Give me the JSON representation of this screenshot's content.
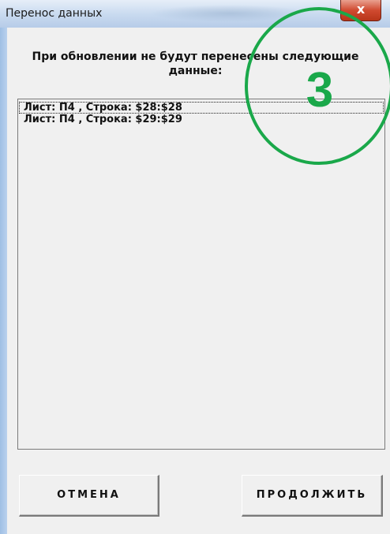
{
  "window": {
    "title": "Перенос данных",
    "close_label": "x"
  },
  "dialog": {
    "header": "При обновлении не будут перенесены следующие данные:"
  },
  "list": {
    "items": [
      "Лист: П4 , Строка: $28:$28",
      "Лист: П4 , Строка: $29:$29"
    ]
  },
  "buttons": {
    "cancel_label": "ОТМЕНА",
    "continue_label": "ПРОДОЛЖИТЬ"
  },
  "annotation": {
    "number": "3",
    "color": "#1aa84a"
  }
}
